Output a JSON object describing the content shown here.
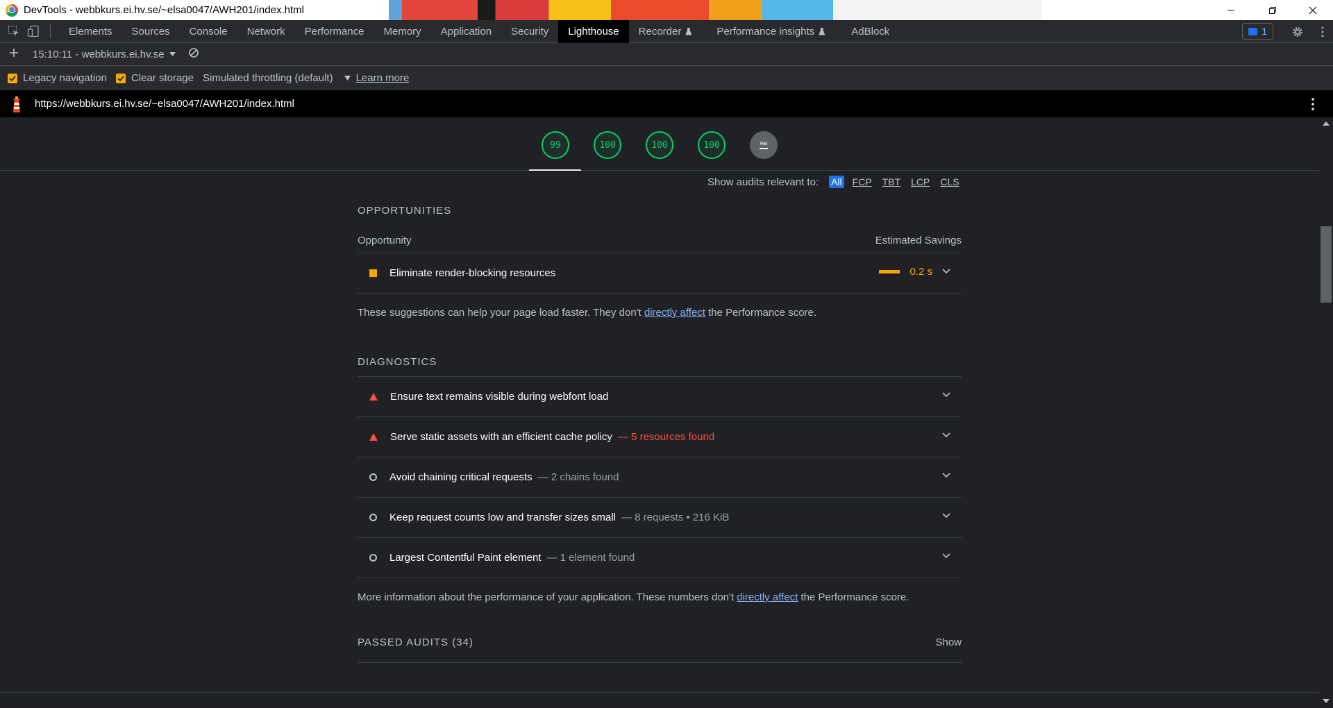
{
  "window": {
    "title": "DevTools - webbkurs.ei.hv.se/~elsa0047/AWH201/index.html"
  },
  "tabs": [
    {
      "label": "Elements"
    },
    {
      "label": "Sources"
    },
    {
      "label": "Console"
    },
    {
      "label": "Network"
    },
    {
      "label": "Performance"
    },
    {
      "label": "Memory"
    },
    {
      "label": "Application"
    },
    {
      "label": "Security"
    },
    {
      "label": "Lighthouse",
      "active": true
    },
    {
      "label": "Recorder"
    },
    {
      "label": "Performance insights"
    },
    {
      "label": "AdBlock"
    }
  ],
  "issues_count": "1",
  "report": {
    "selected": "15:10:11 - webbkurs.ei.hv.se"
  },
  "options": {
    "legacy_navigation": "Legacy navigation",
    "clear_storage": "Clear storage",
    "throttling": "Simulated throttling (default)",
    "learn_more": "Learn more"
  },
  "url": "https://webbkurs.ei.hv.se/~elsa0047/AWH201/index.html",
  "gauges": [
    {
      "value": "99"
    },
    {
      "value": "100"
    },
    {
      "value": "100"
    },
    {
      "value": "100"
    },
    {
      "value": "PWA"
    }
  ],
  "filter": {
    "label": "Show audits relevant to:",
    "options": [
      "All",
      "FCP",
      "TBT",
      "LCP",
      "CLS"
    ],
    "active": "All"
  },
  "opportunities": {
    "title": "OPPORTUNITIES",
    "col_left": "Opportunity",
    "col_right": "Estimated Savings",
    "items": [
      {
        "title": "Eliminate render-blocking resources",
        "savings": "0.2 s"
      }
    ],
    "note_pre": "These suggestions can help your page load faster. They don't ",
    "note_link": "directly affect",
    "note_post": " the Performance score."
  },
  "diagnostics": {
    "title": "DIAGNOSTICS",
    "items": [
      {
        "title": "Ensure text remains visible during webfont load",
        "display": "",
        "status": "fail"
      },
      {
        "title": "Serve static assets with an efficient cache policy",
        "display": "— 5 resources found",
        "status": "fail"
      },
      {
        "title": "Avoid chaining critical requests",
        "display": "— 2 chains found",
        "status": "info"
      },
      {
        "title": "Keep request counts low and transfer sizes small",
        "display": "— 8 requests • 216 KiB",
        "status": "info"
      },
      {
        "title": "Largest Contentful Paint element",
        "display": "— 1 element found",
        "status": "info"
      }
    ],
    "note_pre": "More information about the performance of your application. These numbers don't ",
    "note_link": "directly affect",
    "note_post": " the Performance score."
  },
  "passed": {
    "title": "PASSED AUDITS (34)",
    "toggle": "Show"
  },
  "colors": {
    "pass": "#0cce6b",
    "average": "#ffa400",
    "fail": "#ff4e42",
    "accent": "#1a73e8"
  }
}
